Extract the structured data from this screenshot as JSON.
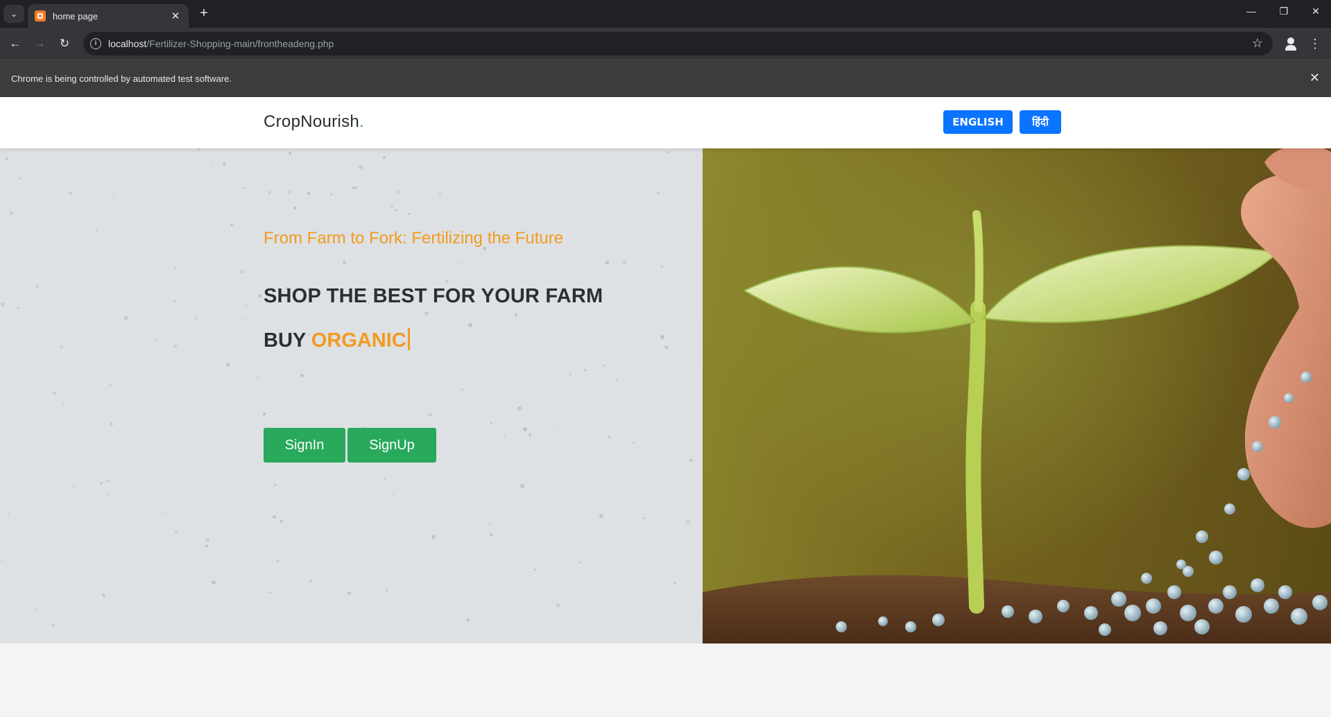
{
  "browser": {
    "tab_title": "home page",
    "url_host": "localhost",
    "url_path": "/Fertilizer-Shopping-main/frontheadeng.php",
    "infobar_text": "Chrome is being controlled by automated test software."
  },
  "header": {
    "brand": "CropNourish",
    "brand_dot": ".",
    "lang_buttons": [
      "ENGLISH",
      "हिंदी"
    ]
  },
  "hero": {
    "tagline": "From Farm to Fork: Fertilizing the Future",
    "headline": "SHOP THE BEST FOR YOUR FARM",
    "buy_prefix": "BUY",
    "buy_accent": "ORGANIC",
    "signin_label": "SignIn",
    "signup_label": "SignUp"
  },
  "colors": {
    "accent_orange": "#f39a1f",
    "button_green": "#28a95c",
    "language_blue": "#0b74ff"
  }
}
